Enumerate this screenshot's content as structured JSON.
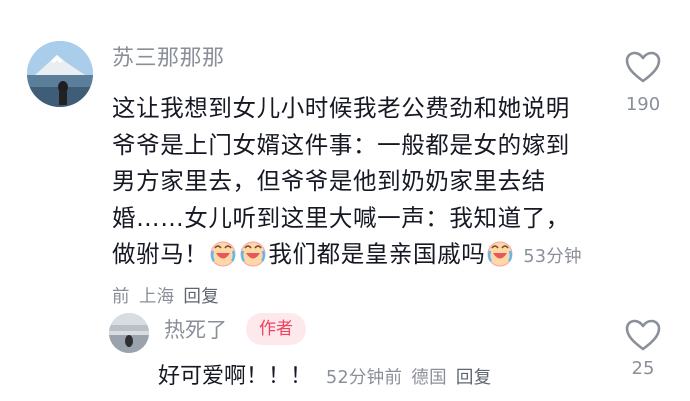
{
  "main_comment": {
    "username": "苏三那那那",
    "text_part1": "这让我想到女儿小时候我老公费劲和她说明爷爷是上门女婿这件事：一般都是女的嫁到男方家里去，但爷爷是他到奶奶家里去结婚……女儿听到这里大喊一声：我知道了，做驸马！",
    "text_part2": "我们都是皇亲国戚吗",
    "emoji_name": "crying-laughing-emoji",
    "time": "53分钟前",
    "location": "上海",
    "reply_label": "回复",
    "like_icon": "heart-outline-icon",
    "like_count": "190"
  },
  "reply_comment": {
    "username": "热死了",
    "badge": "作者",
    "text": "好可爱啊！！！",
    "time": "52分钟前",
    "location": "德国",
    "reply_label": "回复",
    "like_icon": "heart-outline-icon",
    "like_count": "25"
  },
  "colors": {
    "text_primary": "#161823",
    "text_secondary": "#8a8f99",
    "badge_bg": "#fde9ec",
    "badge_text": "#f43f5e"
  }
}
